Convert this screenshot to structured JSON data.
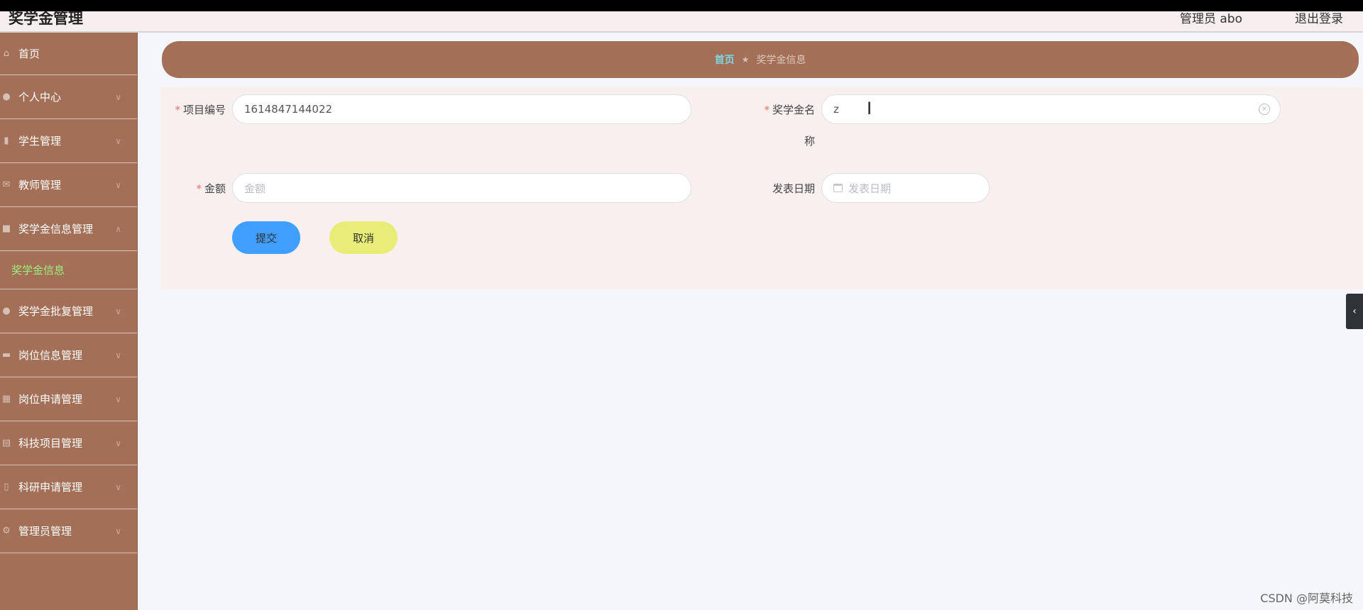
{
  "header": {
    "title": "奖学金管理",
    "user_text": "管理员 abo",
    "logout": "退出登录"
  },
  "sidebar": {
    "items": [
      {
        "label": "首页",
        "icon": "home-icon"
      },
      {
        "label": "个人中心",
        "icon": "user-icon"
      },
      {
        "label": "学生管理",
        "icon": "bar-chart-icon"
      },
      {
        "label": "教师管理",
        "icon": "mail-icon"
      },
      {
        "label": "奖学金信息管理",
        "icon": "briefcase-icon"
      },
      {
        "label": "奖学金批复管理",
        "icon": "user-icon"
      },
      {
        "label": "岗位信息管理",
        "icon": "chart-icon"
      },
      {
        "label": "岗位申请管理",
        "icon": "calendar-icon"
      },
      {
        "label": "科技项目管理",
        "icon": "clipboard-icon"
      },
      {
        "label": "科研申请管理",
        "icon": "mic-icon"
      },
      {
        "label": "管理员管理",
        "icon": "settings-icon"
      }
    ],
    "active_sub": "奖学金信息"
  },
  "breadcrumb": {
    "home": "首页",
    "current": "奖学金信息"
  },
  "form": {
    "project_no_label": "项目编号",
    "project_no_value": "1614847144022",
    "name_label_1": "奖学金名",
    "name_label_2": "称",
    "name_value": "z",
    "amount_label": "金额",
    "amount_placeholder": "金额",
    "date_label": "发表日期",
    "date_placeholder": "发表日期",
    "submit": "提交",
    "cancel": "取消"
  },
  "watermark": "CSDN @阿莫科技"
}
